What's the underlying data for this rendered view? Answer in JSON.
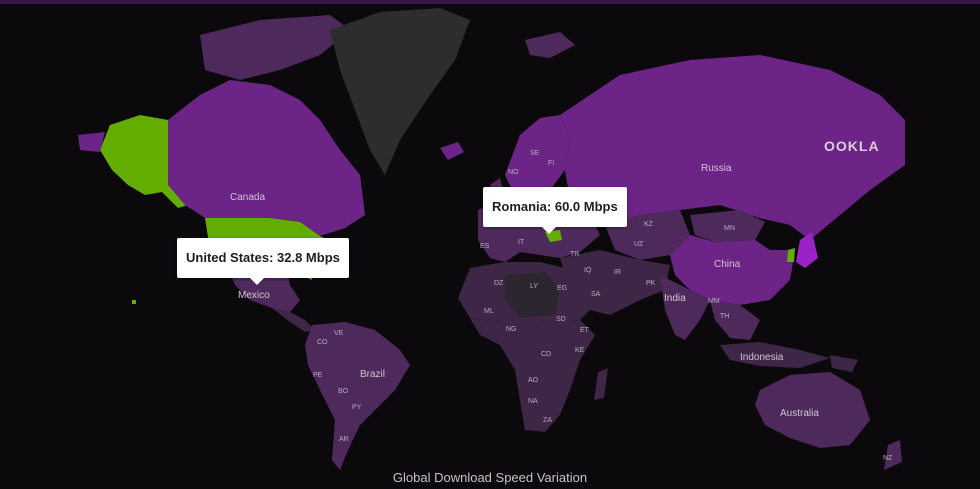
{
  "title": "Global Download Speed Variation",
  "logo": "OOKLA",
  "colors": {
    "background": "#0b090c",
    "land_default": "#3d2646",
    "land_low": "#2c2630",
    "land_mid": "#4e2a5c",
    "land_high": "#6c2586",
    "land_highlight": "#62ad00",
    "greenland": "#2d2d2d",
    "tooltip_bg": "#ffffff"
  },
  "tooltips": {
    "us": "United States: 32.8 Mbps",
    "romania": "Romania: 60.0 Mbps"
  },
  "labels": {
    "russia": "Russia",
    "canada": "Canada",
    "china": "China",
    "india": "India",
    "brazil": "Brazil",
    "australia": "Australia",
    "indonesia": "Indonesia",
    "mexico": "Mexico",
    "se": "SE",
    "no": "NO",
    "fi": "FI",
    "es": "ES",
    "it": "IT",
    "tr": "TR",
    "kz": "KZ",
    "uz": "UZ",
    "mn": "MN",
    "ir": "IR",
    "pk": "PK",
    "iq": "IQ",
    "sa": "SA",
    "eg": "EG",
    "ly": "LY",
    "dz": "DZ",
    "ml": "ML",
    "ng": "NG",
    "sd": "SD",
    "et": "ET",
    "ke": "KE",
    "cd": "CD",
    "ao": "AO",
    "na": "NA",
    "za": "ZA",
    "mm": "MM",
    "th": "TH",
    "ve": "VE",
    "co": "CO",
    "pe": "PE",
    "bo": "BO",
    "py": "PY",
    "ar": "AR",
    "nz": "NZ"
  }
}
